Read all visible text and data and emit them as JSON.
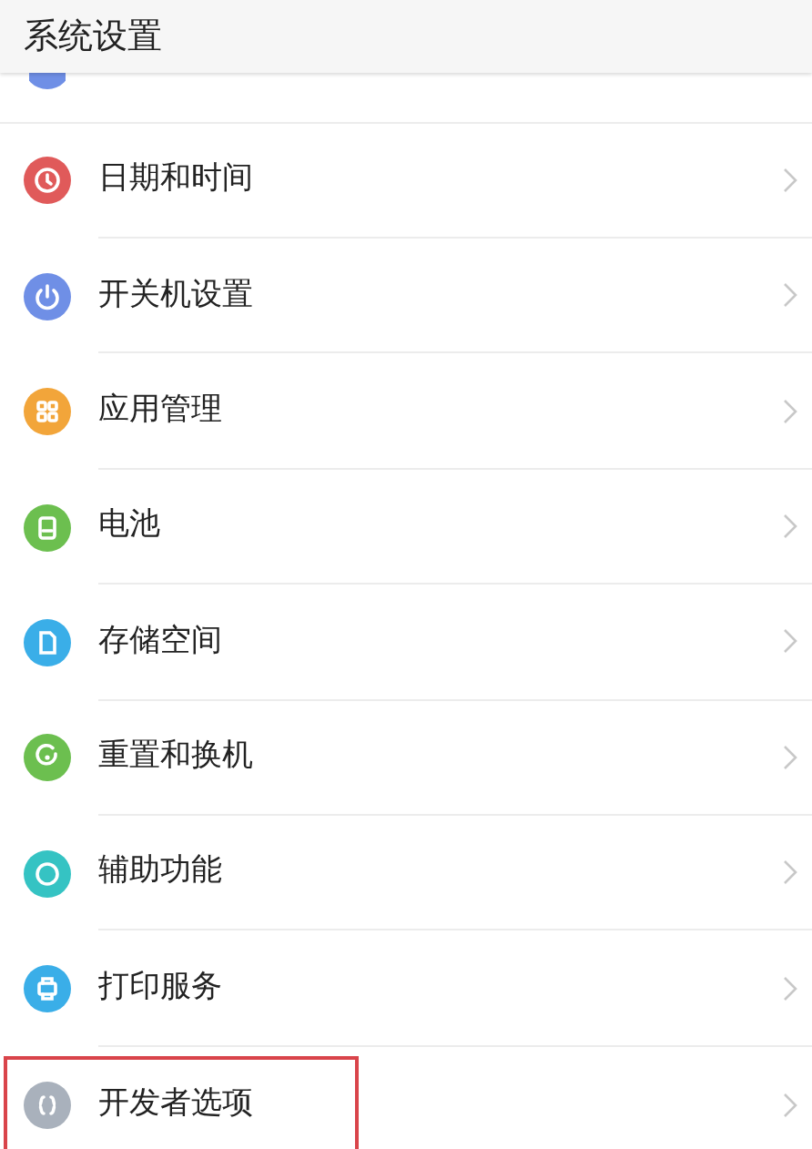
{
  "header": {
    "title": "系统设置"
  },
  "items": [
    {
      "color": "#6f8fe6"
    },
    {
      "label": "日期和时间",
      "color": "#e05a5a",
      "highlighted": false
    },
    {
      "label": "开关机设置",
      "color": "#6f8fe6",
      "highlighted": false
    },
    {
      "label": "应用管理",
      "color": "#f2a53a",
      "highlighted": false
    },
    {
      "label": "电池",
      "color": "#6cbf4f",
      "highlighted": false
    },
    {
      "label": "存储空间",
      "color": "#3aaee8",
      "highlighted": false
    },
    {
      "label": "重置和换机",
      "color": "#6cbf4f",
      "highlighted": false
    },
    {
      "label": "辅助功能",
      "color": "#35c3c3",
      "highlighted": false
    },
    {
      "label": "打印服务",
      "color": "#3aaee8",
      "highlighted": false
    },
    {
      "label": "开发者选项",
      "color": "#a9b1bc",
      "highlighted": true
    }
  ]
}
